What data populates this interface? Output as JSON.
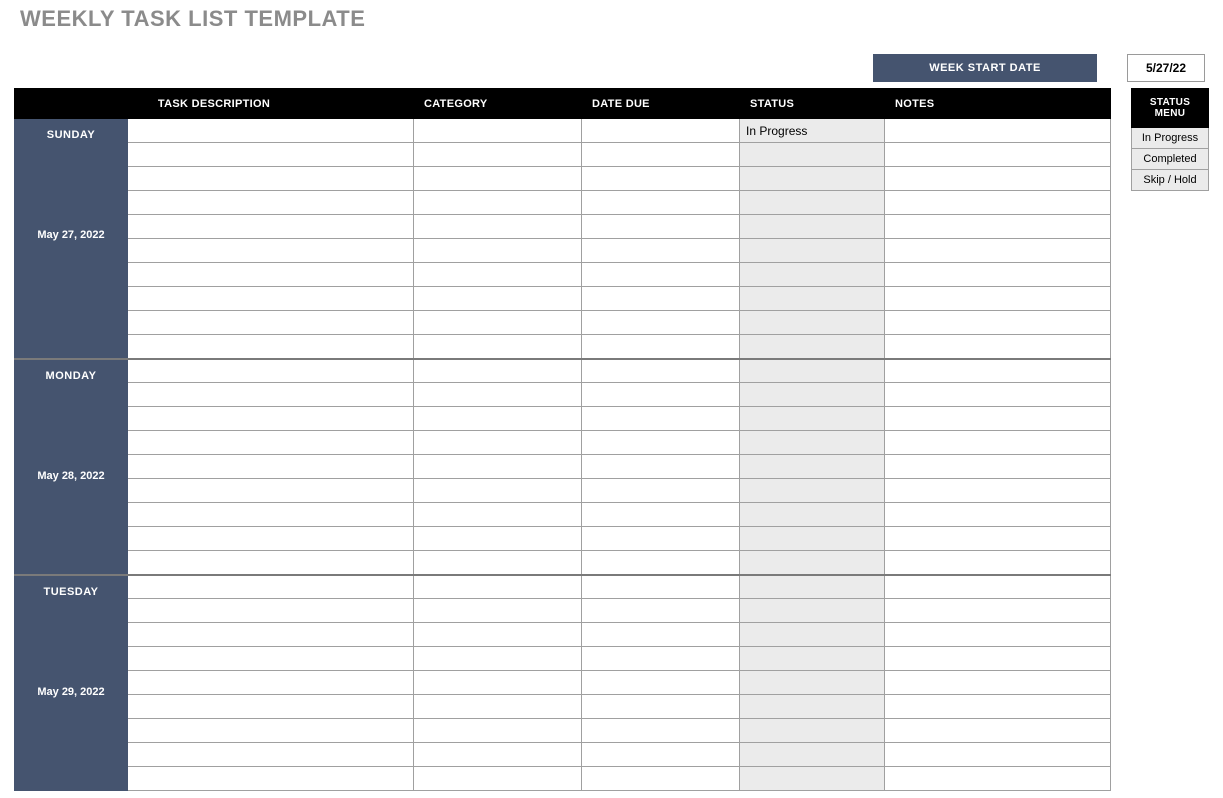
{
  "title": "WEEKLY TASK LIST TEMPLATE",
  "week_start": {
    "label": "WEEK START DATE",
    "value": "5/27/22"
  },
  "columns": {
    "day": "",
    "task_description": "TASK DESCRIPTION",
    "category": "CATEGORY",
    "date_due": "DATE DUE",
    "status": "STATUS",
    "notes": "NOTES"
  },
  "status_menu": {
    "header": "STATUS MENU",
    "items": [
      "In Progress",
      "Completed",
      "Skip / Hold"
    ]
  },
  "days": [
    {
      "name": "SUNDAY",
      "date": "May 27, 2022",
      "rows": [
        {
          "task": "",
          "category": "",
          "due": "",
          "status": "In Progress",
          "notes": ""
        },
        {
          "task": "",
          "category": "",
          "due": "",
          "status": "",
          "notes": ""
        },
        {
          "task": "",
          "category": "",
          "due": "",
          "status": "",
          "notes": ""
        },
        {
          "task": "",
          "category": "",
          "due": "",
          "status": "",
          "notes": ""
        },
        {
          "task": "",
          "category": "",
          "due": "",
          "status": "",
          "notes": ""
        },
        {
          "task": "",
          "category": "",
          "due": "",
          "status": "",
          "notes": ""
        },
        {
          "task": "",
          "category": "",
          "due": "",
          "status": "",
          "notes": ""
        },
        {
          "task": "",
          "category": "",
          "due": "",
          "status": "",
          "notes": ""
        },
        {
          "task": "",
          "category": "",
          "due": "",
          "status": "",
          "notes": ""
        },
        {
          "task": "",
          "category": "",
          "due": "",
          "status": "",
          "notes": ""
        }
      ]
    },
    {
      "name": "MONDAY",
      "date": "May 28, 2022",
      "rows": [
        {
          "task": "",
          "category": "",
          "due": "",
          "status": "",
          "notes": ""
        },
        {
          "task": "",
          "category": "",
          "due": "",
          "status": "",
          "notes": ""
        },
        {
          "task": "",
          "category": "",
          "due": "",
          "status": "",
          "notes": ""
        },
        {
          "task": "",
          "category": "",
          "due": "",
          "status": "",
          "notes": ""
        },
        {
          "task": "",
          "category": "",
          "due": "",
          "status": "",
          "notes": ""
        },
        {
          "task": "",
          "category": "",
          "due": "",
          "status": "",
          "notes": ""
        },
        {
          "task": "",
          "category": "",
          "due": "",
          "status": "",
          "notes": ""
        },
        {
          "task": "",
          "category": "",
          "due": "",
          "status": "",
          "notes": ""
        },
        {
          "task": "",
          "category": "",
          "due": "",
          "status": "",
          "notes": ""
        }
      ]
    },
    {
      "name": "TUESDAY",
      "date": "May 29, 2022",
      "rows": [
        {
          "task": "",
          "category": "",
          "due": "",
          "status": "",
          "notes": ""
        },
        {
          "task": "",
          "category": "",
          "due": "",
          "status": "",
          "notes": ""
        },
        {
          "task": "",
          "category": "",
          "due": "",
          "status": "",
          "notes": ""
        },
        {
          "task": "",
          "category": "",
          "due": "",
          "status": "",
          "notes": ""
        },
        {
          "task": "",
          "category": "",
          "due": "",
          "status": "",
          "notes": ""
        },
        {
          "task": "",
          "category": "",
          "due": "",
          "status": "",
          "notes": ""
        },
        {
          "task": "",
          "category": "",
          "due": "",
          "status": "",
          "notes": ""
        },
        {
          "task": "",
          "category": "",
          "due": "",
          "status": "",
          "notes": ""
        },
        {
          "task": "",
          "category": "",
          "due": "",
          "status": "",
          "notes": ""
        }
      ]
    }
  ]
}
